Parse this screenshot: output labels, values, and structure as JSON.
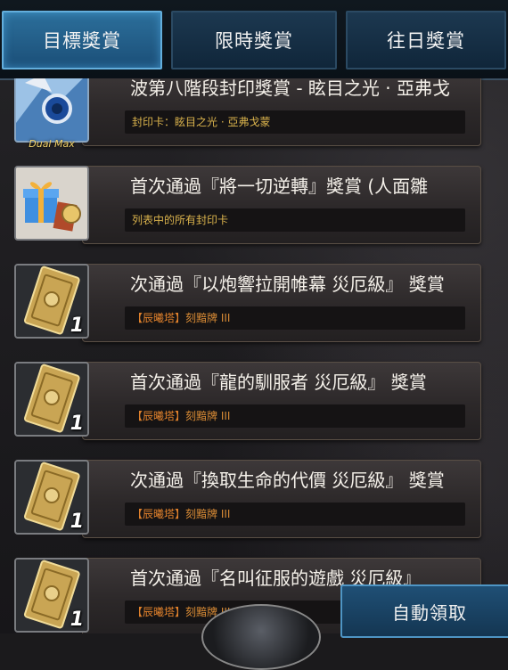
{
  "tabs": [
    {
      "label": "目標獎賞",
      "active": true
    },
    {
      "label": "限時獎賞",
      "active": false
    },
    {
      "label": "往日獎賞",
      "active": false
    }
  ],
  "rows": [
    {
      "title": "波第八階段封印獎賞 - 眩目之光 · 亞弗戈",
      "subtitle": "封印卡：眩目之光 · 亞弗戈蒙",
      "icon": "card-art-icon",
      "badge": "Dual Max"
    },
    {
      "title": "首次通過『將一切逆轉』獎賞 (人面雛",
      "subtitle": "列表中的所有封印卡",
      "icon": "gift-box-icon"
    },
    {
      "title": "次通過『以炮響拉開帷幕 災厄級』 獎賞",
      "subtitle_tag": "【辰曦塔】",
      "subtitle": "刻黯牌 III",
      "icon": "gold-card-icon",
      "qty": "1"
    },
    {
      "title": "首次通過『龍的馴服者 災厄級』 獎賞",
      "subtitle_tag": "【辰曦塔】",
      "subtitle": "刻黯牌 III",
      "icon": "gold-card-icon",
      "qty": "1"
    },
    {
      "title": "次通過『換取生命的代價 災厄級』 獎賞",
      "subtitle_tag": "【辰曦塔】",
      "subtitle": "刻黯牌 III",
      "icon": "gold-card-icon",
      "qty": "1"
    },
    {
      "title": "首次通過『名叫征服的遊戲 災厄級』",
      "subtitle_tag": "【辰曦塔】",
      "subtitle": "刻黯牌 III",
      "icon": "gold-card-icon",
      "qty": "1"
    }
  ],
  "auto_claim_label": "自動領取",
  "colors": {
    "accent": "#63aedc",
    "gold_text": "#d9b24c",
    "orange_text": "#d98b35"
  }
}
